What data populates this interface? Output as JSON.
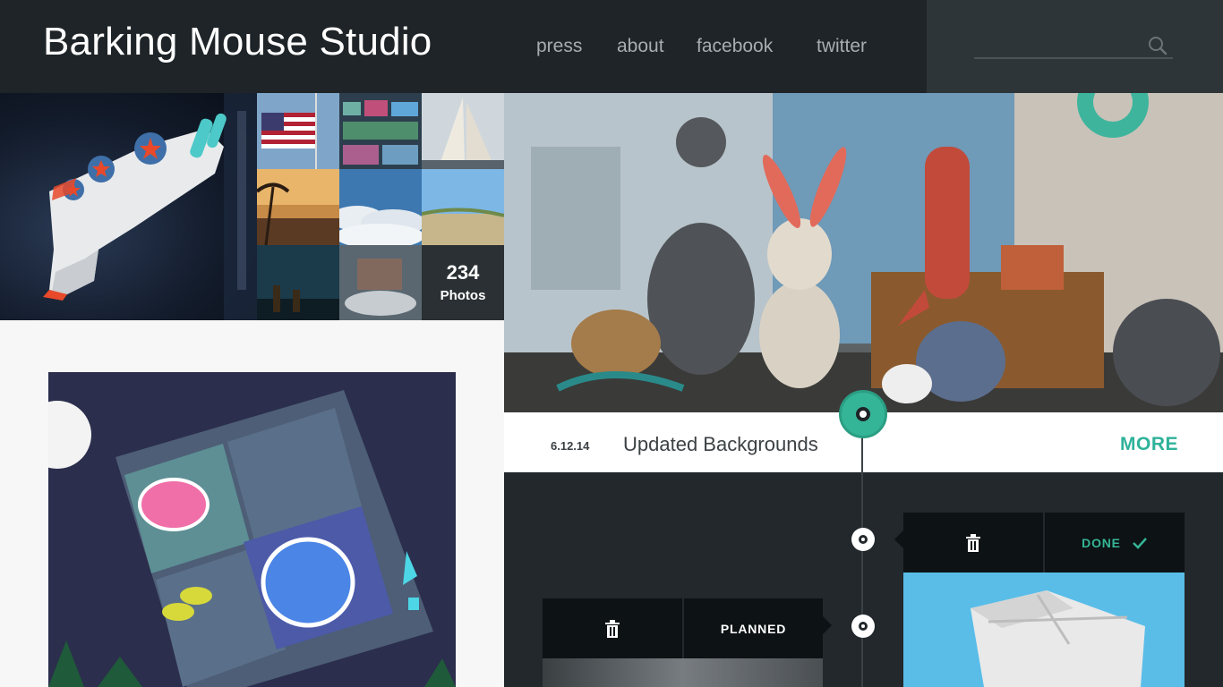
{
  "header": {
    "brand": "Barking Mouse Studio",
    "nav": [
      "press",
      "about",
      "facebook",
      "twitter"
    ],
    "search_placeholder": ""
  },
  "gallery": {
    "count": "234",
    "count_label": "Photos"
  },
  "post": {
    "date": "6.12.14",
    "title": "Updated Backgrounds",
    "more_label": "MORE"
  },
  "cards": {
    "planned_label": "PLANNED",
    "done_label": "DONE"
  },
  "colors": {
    "accent": "#35b597",
    "header_bg": "#1e2427",
    "dark_bg": "#22282b"
  }
}
